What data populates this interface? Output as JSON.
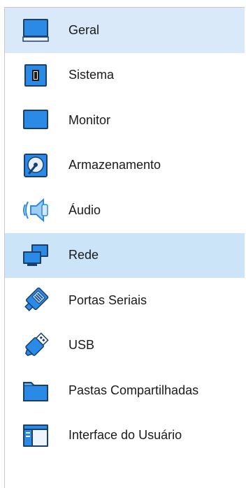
{
  "settings_nav": {
    "selected_index": 0,
    "hovered_index": 5,
    "items": [
      {
        "label": "Geral",
        "icon": "computer-icon"
      },
      {
        "label": "Sistema",
        "icon": "chip-icon"
      },
      {
        "label": "Monitor",
        "icon": "monitor-icon"
      },
      {
        "label": "Armazenamento",
        "icon": "storage-icon"
      },
      {
        "label": "Áudio",
        "icon": "speaker-icon"
      },
      {
        "label": "Rede",
        "icon": "network-icon"
      },
      {
        "label": "Portas Seriais",
        "icon": "serial-port-icon"
      },
      {
        "label": "USB",
        "icon": "usb-icon"
      },
      {
        "label": "Pastas Compartilhadas",
        "icon": "shared-folder-icon"
      },
      {
        "label": "Interface do Usuário",
        "icon": "user-interface-icon"
      }
    ]
  },
  "colors": {
    "selected_bg": "#d9e9f9",
    "hover_bg": "#cce4f7",
    "icon_blue": "#1f7fd8",
    "icon_dark": "#1b3f6b"
  }
}
